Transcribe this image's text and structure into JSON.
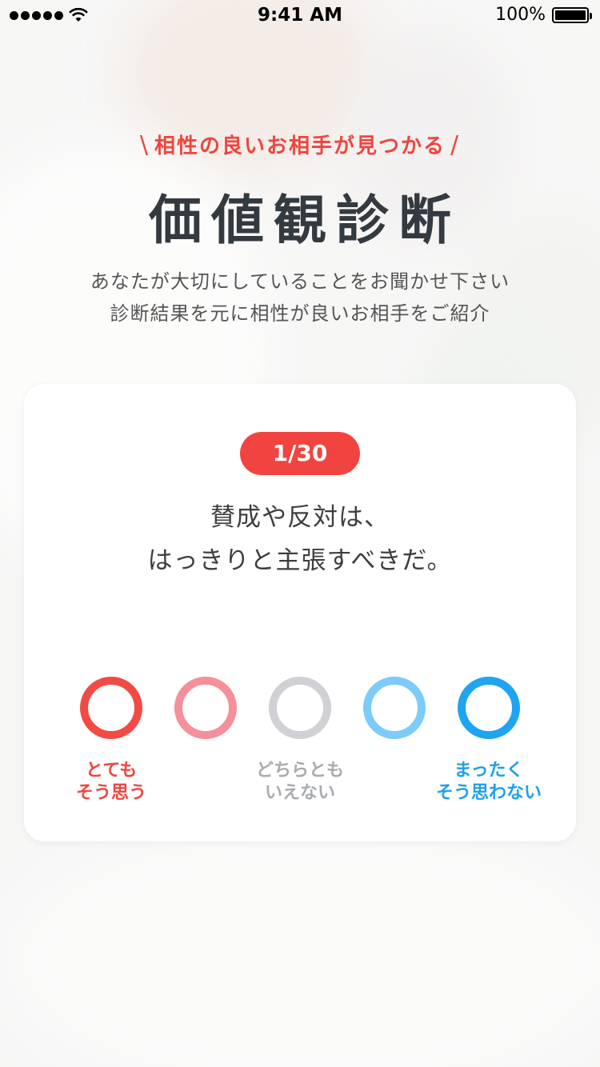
{
  "status_bar": {
    "time": "9:41 AM",
    "battery": "100%",
    "battery_level": 1.0
  },
  "header": {
    "tagline": "相性の良いお相手が見つかる",
    "tagline_left": "\\",
    "tagline_right": "/",
    "title": "価値観診断",
    "description_line1": "あなたが大切にしていることをお聞かせ下さい",
    "description_line2": "診断結果を元に相性が良いお相手をご紹介"
  },
  "question_card": {
    "progress": "1/30",
    "question_line1": "賛成や反対は、",
    "question_line2": "はっきりと主張すべきだ。",
    "options": [
      {
        "icon": "circle-option-strong-agree",
        "color": "#f24a45"
      },
      {
        "icon": "circle-option-agree",
        "color": "#f58f9a"
      },
      {
        "icon": "circle-option-neutral",
        "color": "#d0d1d4"
      },
      {
        "icon": "circle-option-disagree",
        "color": "#7ccbf8"
      },
      {
        "icon": "circle-option-strong-disagree",
        "color": "#1ea4f0"
      }
    ],
    "labels": {
      "agree_line1": "とても",
      "agree_line2": "そう思う",
      "neutral_line1": "どちらとも",
      "neutral_line2": "いえない",
      "disagree_line1": "まったく",
      "disagree_line2": "そう思わない"
    }
  },
  "colors": {
    "accent_red": "#f0453f",
    "accent_blue": "#1ea0ec",
    "title_text": "#333a40"
  }
}
